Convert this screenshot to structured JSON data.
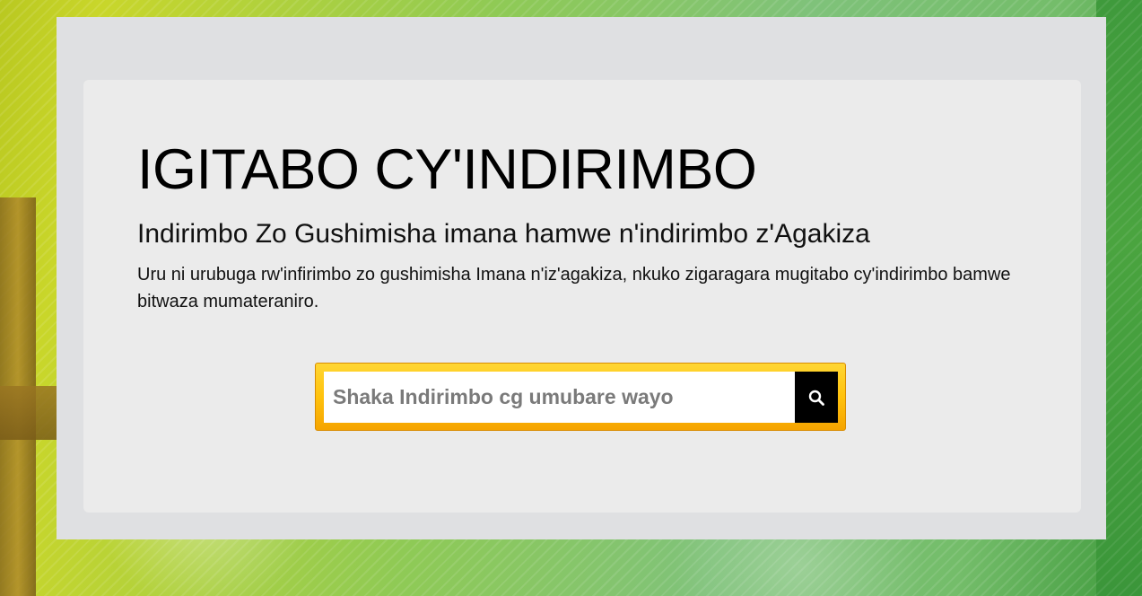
{
  "header": {
    "title": "IGITABO CY'INDIRIMBO",
    "subtitle": "Indirimbo Zo Gushimisha imana hamwe n'indirimbo z'Agakiza",
    "description": "Uru ni urubuga rw'infirimbo zo gushimisha Imana n'iz'agakiza, nkuko zigaragara mugitabo cy'indirimbo bamwe bitwaza mumateraniro."
  },
  "search": {
    "value": "",
    "placeholder": "Shaka Indirimbo cg umubare wayo",
    "button_icon": "search-icon"
  },
  "colors": {
    "search_frame": "#ffc20d",
    "search_button": "#000000",
    "panel": "#ebebeb",
    "outer_panel": "#dfe0e2"
  }
}
